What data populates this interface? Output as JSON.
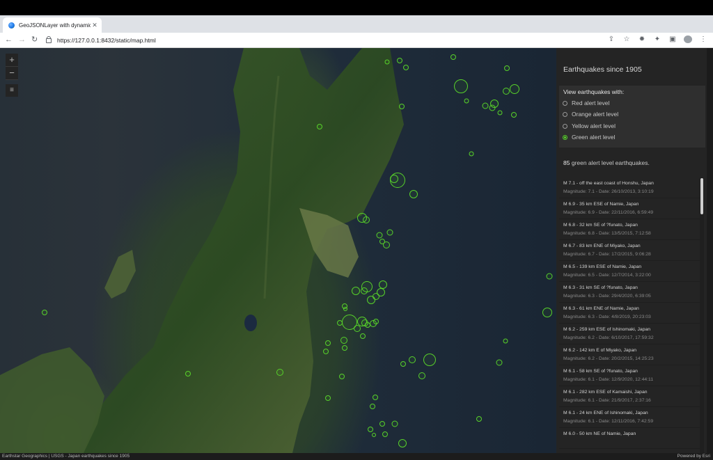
{
  "browser": {
    "tab_title": "GeoJSONLayer with dynamic l",
    "tab_close": "✕",
    "new_tab": "+",
    "url": "https://127.0.0.1:8432/static/map.html",
    "back": "←",
    "forward": "→",
    "reload": "↻"
  },
  "map": {
    "zoom_in": "+",
    "zoom_out": "−",
    "layers_icon": "≡",
    "attribution": "Earthstar Geographics | USGS - Japan earthquakes since 1905",
    "powered_by": "Powered by Esri",
    "marker_color": "#57d12a"
  },
  "panel": {
    "title": "Earthquakes since 1905",
    "filter_title": "View earthquakes with:",
    "options": [
      {
        "label": "Red alert level",
        "checked": false
      },
      {
        "label": "Orange alert level",
        "checked": false
      },
      {
        "label": "Yellow alert level",
        "checked": false
      },
      {
        "label": "Green alert level",
        "checked": true
      }
    ],
    "count_number": "85",
    "count_text": " green alert level earthquakes.",
    "items": [
      {
        "title": "M 7.1 - off the east coast of Honshu, Japan",
        "sub": "Magnitude: 7.1 - Date: 26/10/2013, 3:10:19"
      },
      {
        "title": "M 6.9 - 35 km ESE of Namie, Japan",
        "sub": "Magnitude: 6.9 - Date: 22/11/2016, 6:59:49"
      },
      {
        "title": "M 6.8 - 32 km SE of ?funato, Japan",
        "sub": "Magnitude: 6.8 - Date: 13/5/2015, 7:12:58"
      },
      {
        "title": "M 6.7 - 83 km ENE of Miyako, Japan",
        "sub": "Magnitude: 6.7 - Date: 17/2/2015, 9:06:28"
      },
      {
        "title": "M 6.5 - 139 km ESE of Namie, Japan",
        "sub": "Magnitude: 6.5 - Date: 12/7/2014, 3:22:00"
      },
      {
        "title": "M 6.3 - 31 km SE of ?funato, Japan",
        "sub": "Magnitude: 6.3 - Date: 29/4/2020, 6:39:05"
      },
      {
        "title": "M 6.3 - 61 km ENE of Namie, Japan",
        "sub": "Magnitude: 6.3 - Date: 4/8/2019, 20:23:03"
      },
      {
        "title": "M 6.2 - 259 km ESE of Ishinomaki, Japan",
        "sub": "Magnitude: 6.2 - Date: 6/10/2017, 17:59:32"
      },
      {
        "title": "M 6.2 - 142 km E of Miyako, Japan",
        "sub": "Magnitude: 6.2 - Date: 20/2/2015, 14:25:23"
      },
      {
        "title": "M 6.1 - 58 km SE of ?funato, Japan",
        "sub": "Magnitude: 6.1 - Date: 12/9/2020, 12:44:11"
      },
      {
        "title": "M 6.1 - 282 km ESE of Kamaishi, Japan",
        "sub": "Magnitude: 6.1 - Date: 21/9/2017, 2:37:16"
      },
      {
        "title": "M 6.1 - 24 km ENE of Ishinomaki, Japan",
        "sub": "Magnitude: 6.1 - Date: 12/11/2016, 7:42:59"
      },
      {
        "title": "M 6.0 - 50 km NE of Namie, Japan",
        "sub": ""
      }
    ]
  }
}
